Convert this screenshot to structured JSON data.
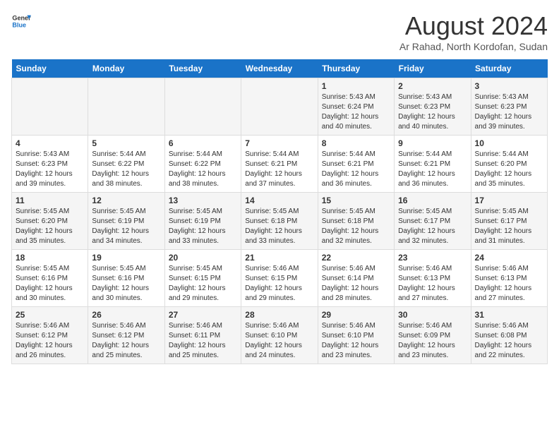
{
  "logo": {
    "line1": "General",
    "line2": "Blue"
  },
  "title": {
    "month_year": "August 2024",
    "location": "Ar Rahad, North Kordofan, Sudan"
  },
  "days_of_week": [
    "Sunday",
    "Monday",
    "Tuesday",
    "Wednesday",
    "Thursday",
    "Friday",
    "Saturday"
  ],
  "weeks": [
    [
      {
        "day": "",
        "info": ""
      },
      {
        "day": "",
        "info": ""
      },
      {
        "day": "",
        "info": ""
      },
      {
        "day": "",
        "info": ""
      },
      {
        "day": "1",
        "sunrise": "Sunrise: 5:43 AM",
        "sunset": "Sunset: 6:24 PM",
        "daylight": "Daylight: 12 hours and 40 minutes."
      },
      {
        "day": "2",
        "sunrise": "Sunrise: 5:43 AM",
        "sunset": "Sunset: 6:23 PM",
        "daylight": "Daylight: 12 hours and 40 minutes."
      },
      {
        "day": "3",
        "sunrise": "Sunrise: 5:43 AM",
        "sunset": "Sunset: 6:23 PM",
        "daylight": "Daylight: 12 hours and 39 minutes."
      }
    ],
    [
      {
        "day": "4",
        "sunrise": "Sunrise: 5:43 AM",
        "sunset": "Sunset: 6:23 PM",
        "daylight": "Daylight: 12 hours and 39 minutes."
      },
      {
        "day": "5",
        "sunrise": "Sunrise: 5:44 AM",
        "sunset": "Sunset: 6:22 PM",
        "daylight": "Daylight: 12 hours and 38 minutes."
      },
      {
        "day": "6",
        "sunrise": "Sunrise: 5:44 AM",
        "sunset": "Sunset: 6:22 PM",
        "daylight": "Daylight: 12 hours and 38 minutes."
      },
      {
        "day": "7",
        "sunrise": "Sunrise: 5:44 AM",
        "sunset": "Sunset: 6:21 PM",
        "daylight": "Daylight: 12 hours and 37 minutes."
      },
      {
        "day": "8",
        "sunrise": "Sunrise: 5:44 AM",
        "sunset": "Sunset: 6:21 PM",
        "daylight": "Daylight: 12 hours and 36 minutes."
      },
      {
        "day": "9",
        "sunrise": "Sunrise: 5:44 AM",
        "sunset": "Sunset: 6:21 PM",
        "daylight": "Daylight: 12 hours and 36 minutes."
      },
      {
        "day": "10",
        "sunrise": "Sunrise: 5:44 AM",
        "sunset": "Sunset: 6:20 PM",
        "daylight": "Daylight: 12 hours and 35 minutes."
      }
    ],
    [
      {
        "day": "11",
        "sunrise": "Sunrise: 5:45 AM",
        "sunset": "Sunset: 6:20 PM",
        "daylight": "Daylight: 12 hours and 35 minutes."
      },
      {
        "day": "12",
        "sunrise": "Sunrise: 5:45 AM",
        "sunset": "Sunset: 6:19 PM",
        "daylight": "Daylight: 12 hours and 34 minutes."
      },
      {
        "day": "13",
        "sunrise": "Sunrise: 5:45 AM",
        "sunset": "Sunset: 6:19 PM",
        "daylight": "Daylight: 12 hours and 33 minutes."
      },
      {
        "day": "14",
        "sunrise": "Sunrise: 5:45 AM",
        "sunset": "Sunset: 6:18 PM",
        "daylight": "Daylight: 12 hours and 33 minutes."
      },
      {
        "day": "15",
        "sunrise": "Sunrise: 5:45 AM",
        "sunset": "Sunset: 6:18 PM",
        "daylight": "Daylight: 12 hours and 32 minutes."
      },
      {
        "day": "16",
        "sunrise": "Sunrise: 5:45 AM",
        "sunset": "Sunset: 6:17 PM",
        "daylight": "Daylight: 12 hours and 32 minutes."
      },
      {
        "day": "17",
        "sunrise": "Sunrise: 5:45 AM",
        "sunset": "Sunset: 6:17 PM",
        "daylight": "Daylight: 12 hours and 31 minutes."
      }
    ],
    [
      {
        "day": "18",
        "sunrise": "Sunrise: 5:45 AM",
        "sunset": "Sunset: 6:16 PM",
        "daylight": "Daylight: 12 hours and 30 minutes."
      },
      {
        "day": "19",
        "sunrise": "Sunrise: 5:45 AM",
        "sunset": "Sunset: 6:16 PM",
        "daylight": "Daylight: 12 hours and 30 minutes."
      },
      {
        "day": "20",
        "sunrise": "Sunrise: 5:45 AM",
        "sunset": "Sunset: 6:15 PM",
        "daylight": "Daylight: 12 hours and 29 minutes."
      },
      {
        "day": "21",
        "sunrise": "Sunrise: 5:46 AM",
        "sunset": "Sunset: 6:15 PM",
        "daylight": "Daylight: 12 hours and 29 minutes."
      },
      {
        "day": "22",
        "sunrise": "Sunrise: 5:46 AM",
        "sunset": "Sunset: 6:14 PM",
        "daylight": "Daylight: 12 hours and 28 minutes."
      },
      {
        "day": "23",
        "sunrise": "Sunrise: 5:46 AM",
        "sunset": "Sunset: 6:13 PM",
        "daylight": "Daylight: 12 hours and 27 minutes."
      },
      {
        "day": "24",
        "sunrise": "Sunrise: 5:46 AM",
        "sunset": "Sunset: 6:13 PM",
        "daylight": "Daylight: 12 hours and 27 minutes."
      }
    ],
    [
      {
        "day": "25",
        "sunrise": "Sunrise: 5:46 AM",
        "sunset": "Sunset: 6:12 PM",
        "daylight": "Daylight: 12 hours and 26 minutes."
      },
      {
        "day": "26",
        "sunrise": "Sunrise: 5:46 AM",
        "sunset": "Sunset: 6:12 PM",
        "daylight": "Daylight: 12 hours and 25 minutes."
      },
      {
        "day": "27",
        "sunrise": "Sunrise: 5:46 AM",
        "sunset": "Sunset: 6:11 PM",
        "daylight": "Daylight: 12 hours and 25 minutes."
      },
      {
        "day": "28",
        "sunrise": "Sunrise: 5:46 AM",
        "sunset": "Sunset: 6:10 PM",
        "daylight": "Daylight: 12 hours and 24 minutes."
      },
      {
        "day": "29",
        "sunrise": "Sunrise: 5:46 AM",
        "sunset": "Sunset: 6:10 PM",
        "daylight": "Daylight: 12 hours and 23 minutes."
      },
      {
        "day": "30",
        "sunrise": "Sunrise: 5:46 AM",
        "sunset": "Sunset: 6:09 PM",
        "daylight": "Daylight: 12 hours and 23 minutes."
      },
      {
        "day": "31",
        "sunrise": "Sunrise: 5:46 AM",
        "sunset": "Sunset: 6:08 PM",
        "daylight": "Daylight: 12 hours and 22 minutes."
      }
    ]
  ]
}
